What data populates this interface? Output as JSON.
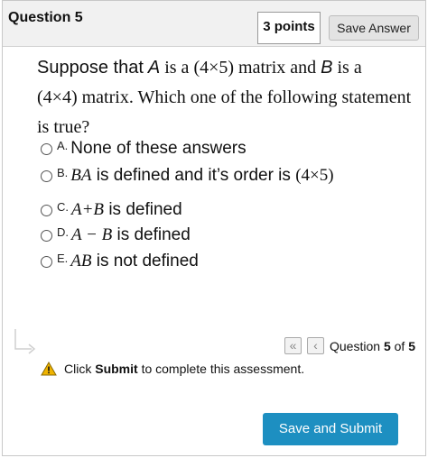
{
  "header": {
    "question_title": "Question 5",
    "points": "3 points",
    "save_label": "Save Answer"
  },
  "question": {
    "t1": "Suppose that",
    "var_a": "A",
    "t2": "is a",
    "dims1": "(4×5)",
    "t3": "matrix and",
    "var_b": "B",
    "t4": "is a",
    "dims2": "(4×4)",
    "t5": "matrix. Which one of the following statement is true?"
  },
  "options": [
    {
      "letter": "A.",
      "text": "None of these answers"
    },
    {
      "letter": "B.",
      "math": "BA",
      "text": "is defined and it’s order is",
      "dims": "(4×5)"
    },
    {
      "letter": "C.",
      "math": "A+B",
      "text": "is defined"
    },
    {
      "letter": "D.",
      "math": "A − B",
      "text": "is defined"
    },
    {
      "letter": "E.",
      "math": "AB",
      "text": "is not defined"
    }
  ],
  "navigation": {
    "first_icon": "double-chevron-left-icon",
    "prev_icon": "chevron-left-icon",
    "prefix": "Question",
    "current": "5",
    "sep": "of",
    "total": "5"
  },
  "notice": {
    "pre": "Click",
    "bold": "Submit",
    "post": "to complete this assessment."
  },
  "submit_label": "Save and Submit",
  "colors": {
    "accent": "#1d8fc1",
    "warning": "#f0b400",
    "header_bg": "#f1f1f1"
  }
}
